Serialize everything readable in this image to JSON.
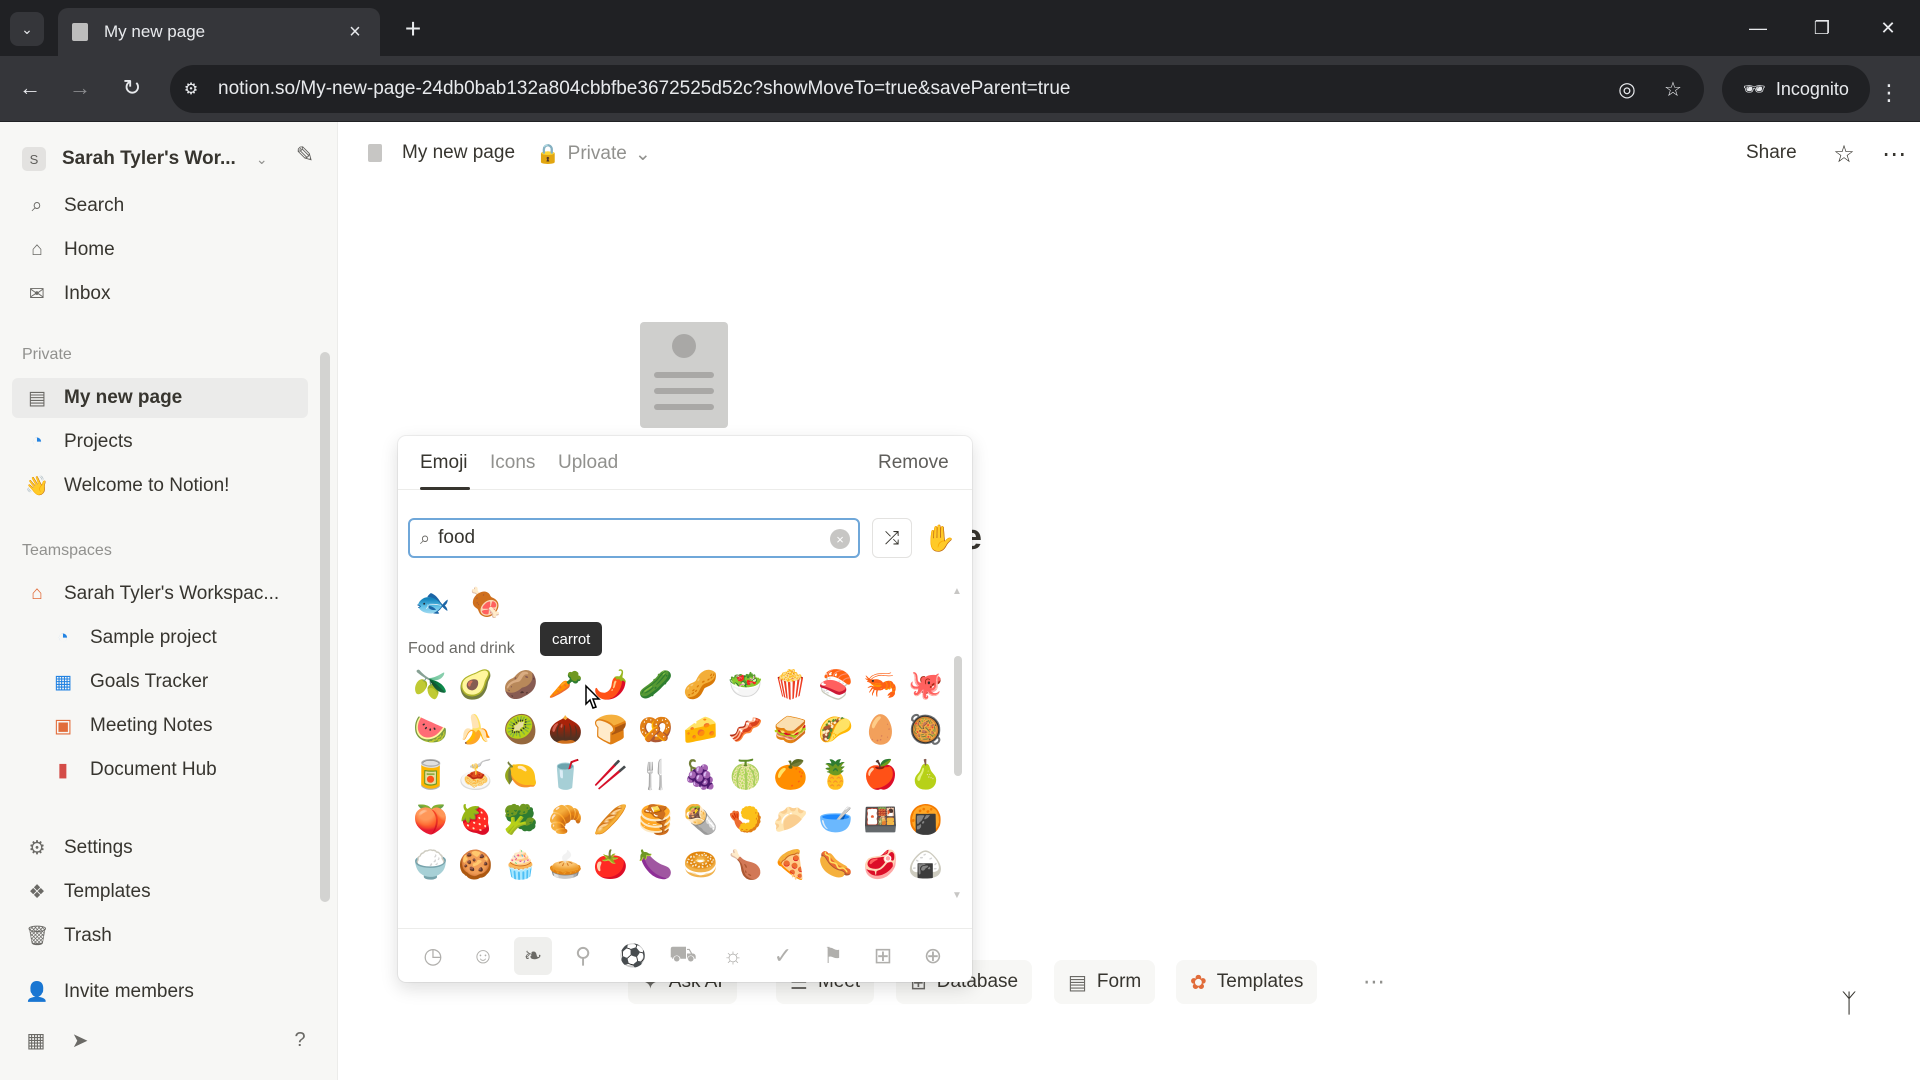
{
  "browser": {
    "tab_title": "My new page",
    "url": "notion.so/My-new-page-24db0bab132a804cbbfbe3672525d52c?showMoveTo=true&saveParent=true",
    "incognito_label": "Incognito"
  },
  "sidebar": {
    "workspace_initial": "S",
    "workspace_name": "Sarah Tyler's Wor...",
    "top_items": [
      {
        "label": "Search",
        "icon": "search-icon"
      },
      {
        "label": "Home",
        "icon": "home-icon"
      },
      {
        "label": "Inbox",
        "icon": "inbox-icon"
      }
    ],
    "private_label": "Private",
    "private_items": [
      {
        "label": "My new page",
        "icon": "page-icon"
      },
      {
        "label": "Projects",
        "icon": "projects-icon"
      },
      {
        "label": "Welcome to Notion!",
        "icon": "wave-icon"
      }
    ],
    "teamspaces_label": "Teamspaces",
    "teamspace_name": "Sarah Tyler's Workspac...",
    "teamspace_items": [
      {
        "label": "Sample project",
        "icon": "projects-icon"
      },
      {
        "label": "Goals Tracker",
        "icon": "chart-icon"
      },
      {
        "label": "Meeting Notes",
        "icon": "calendar-icon"
      },
      {
        "label": "Document Hub",
        "icon": "document-icon"
      }
    ],
    "bottom_items": [
      {
        "label": "Settings",
        "icon": "gear-icon"
      },
      {
        "label": "Templates",
        "icon": "templates-icon"
      },
      {
        "label": "Trash",
        "icon": "trash-icon"
      }
    ],
    "invite_label": "Invite members"
  },
  "header": {
    "page_title": "My new page",
    "privacy": "Private",
    "share_label": "Share"
  },
  "picker": {
    "tabs": [
      "Emoji",
      "Icons",
      "Upload"
    ],
    "remove_label": "Remove",
    "search_value": "food",
    "recent_emojis": [
      "🐟",
      "🍖"
    ],
    "category_label": "Food and drink",
    "tooltip": "carrot",
    "emojis": [
      "🫒",
      "🥑",
      "🥔",
      "🥕",
      "🌶️",
      "🥒",
      "🥜",
      "🥗",
      "🍿",
      "🍣",
      "🦐",
      "🐙",
      "🍉",
      "🍌",
      "🥝",
      "🌰",
      "🍞",
      "🥨",
      "🧀",
      "🥓",
      "🥪",
      "🌮",
      "🥚",
      "🥘",
      "🥫",
      "🍝",
      "🍋",
      "🥤",
      "🥢",
      "🍴",
      "🍇",
      "🍈",
      "🍊",
      "🍍",
      "🍎",
      "🍐",
      "🍑",
      "🍓",
      "🥦",
      "🥐",
      "🥖",
      "🥞",
      "🌯",
      "🍤",
      "🥟",
      "🥣",
      "🍱",
      "🍘",
      "🍚",
      "🍪",
      "🧁",
      "🥧",
      "🍅",
      "🍆",
      "🥯",
      "🍗",
      "🍕",
      "🌭",
      "🥩",
      "🍙"
    ],
    "category_icons": [
      "clock-icon",
      "smiley-icon",
      "leaf-icon",
      "food-icon",
      "ball-icon",
      "car-icon",
      "lightbulb-icon",
      "check-icon",
      "flag-icon",
      "grid-icon",
      "plus-circle-icon"
    ]
  },
  "quick_actions": [
    "Ask AI",
    "Meet",
    "Database",
    "Form",
    "Templates"
  ],
  "colors": {
    "accent_blue": "#2383e2",
    "sidebar_bg": "#f7f7f5",
    "chrome_dark": "#202124"
  }
}
